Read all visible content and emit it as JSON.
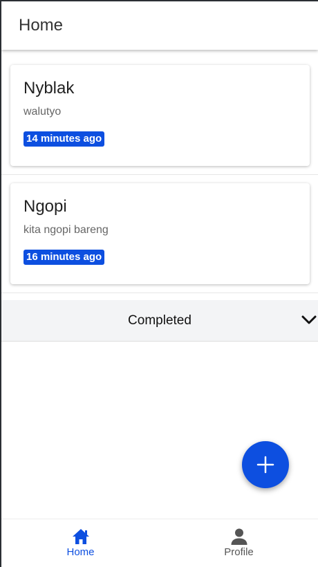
{
  "header": {
    "title": "Home"
  },
  "tasks": [
    {
      "title": "Nyblak",
      "subtitle": "walutyo",
      "time": "14 minutes ago"
    },
    {
      "title": "Ngopi",
      "subtitle": "kita ngopi bareng",
      "time": "16 minutes ago"
    }
  ],
  "completed_section": {
    "label": "Completed",
    "icon": "chevron-down-icon"
  },
  "fab": {
    "icon": "plus-icon"
  },
  "bottom_nav": {
    "items": [
      {
        "label": "Home",
        "icon": "home-icon",
        "active": true
      },
      {
        "label": "Profile",
        "icon": "person-icon",
        "active": false
      }
    ]
  },
  "colors": {
    "accent": "#0d4fe0",
    "badge_text": "#ffffff",
    "section_bg": "#f3f4f6"
  }
}
